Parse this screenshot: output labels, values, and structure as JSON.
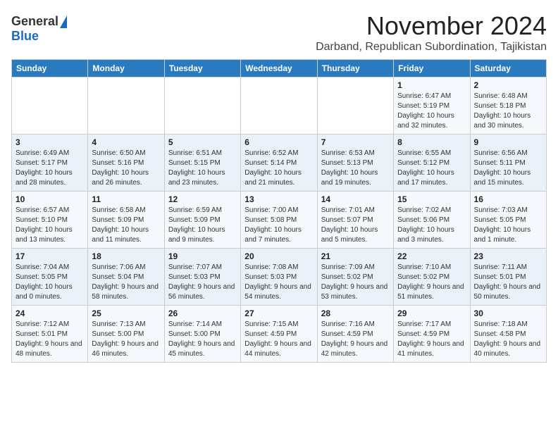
{
  "header": {
    "logo_general": "General",
    "logo_blue": "Blue",
    "month_title": "November 2024",
    "location": "Darband, Republican Subordination, Tajikistan"
  },
  "weekdays": [
    "Sunday",
    "Monday",
    "Tuesday",
    "Wednesday",
    "Thursday",
    "Friday",
    "Saturday"
  ],
  "weeks": [
    [
      {
        "day": "",
        "info": ""
      },
      {
        "day": "",
        "info": ""
      },
      {
        "day": "",
        "info": ""
      },
      {
        "day": "",
        "info": ""
      },
      {
        "day": "",
        "info": ""
      },
      {
        "day": "1",
        "info": "Sunrise: 6:47 AM\nSunset: 5:19 PM\nDaylight: 10 hours and 32 minutes."
      },
      {
        "day": "2",
        "info": "Sunrise: 6:48 AM\nSunset: 5:18 PM\nDaylight: 10 hours and 30 minutes."
      }
    ],
    [
      {
        "day": "3",
        "info": "Sunrise: 6:49 AM\nSunset: 5:17 PM\nDaylight: 10 hours and 28 minutes."
      },
      {
        "day": "4",
        "info": "Sunrise: 6:50 AM\nSunset: 5:16 PM\nDaylight: 10 hours and 26 minutes."
      },
      {
        "day": "5",
        "info": "Sunrise: 6:51 AM\nSunset: 5:15 PM\nDaylight: 10 hours and 23 minutes."
      },
      {
        "day": "6",
        "info": "Sunrise: 6:52 AM\nSunset: 5:14 PM\nDaylight: 10 hours and 21 minutes."
      },
      {
        "day": "7",
        "info": "Sunrise: 6:53 AM\nSunset: 5:13 PM\nDaylight: 10 hours and 19 minutes."
      },
      {
        "day": "8",
        "info": "Sunrise: 6:55 AM\nSunset: 5:12 PM\nDaylight: 10 hours and 17 minutes."
      },
      {
        "day": "9",
        "info": "Sunrise: 6:56 AM\nSunset: 5:11 PM\nDaylight: 10 hours and 15 minutes."
      }
    ],
    [
      {
        "day": "10",
        "info": "Sunrise: 6:57 AM\nSunset: 5:10 PM\nDaylight: 10 hours and 13 minutes."
      },
      {
        "day": "11",
        "info": "Sunrise: 6:58 AM\nSunset: 5:09 PM\nDaylight: 10 hours and 11 minutes."
      },
      {
        "day": "12",
        "info": "Sunrise: 6:59 AM\nSunset: 5:09 PM\nDaylight: 10 hours and 9 minutes."
      },
      {
        "day": "13",
        "info": "Sunrise: 7:00 AM\nSunset: 5:08 PM\nDaylight: 10 hours and 7 minutes."
      },
      {
        "day": "14",
        "info": "Sunrise: 7:01 AM\nSunset: 5:07 PM\nDaylight: 10 hours and 5 minutes."
      },
      {
        "day": "15",
        "info": "Sunrise: 7:02 AM\nSunset: 5:06 PM\nDaylight: 10 hours and 3 minutes."
      },
      {
        "day": "16",
        "info": "Sunrise: 7:03 AM\nSunset: 5:05 PM\nDaylight: 10 hours and 1 minute."
      }
    ],
    [
      {
        "day": "17",
        "info": "Sunrise: 7:04 AM\nSunset: 5:05 PM\nDaylight: 10 hours and 0 minutes."
      },
      {
        "day": "18",
        "info": "Sunrise: 7:06 AM\nSunset: 5:04 PM\nDaylight: 9 hours and 58 minutes."
      },
      {
        "day": "19",
        "info": "Sunrise: 7:07 AM\nSunset: 5:03 PM\nDaylight: 9 hours and 56 minutes."
      },
      {
        "day": "20",
        "info": "Sunrise: 7:08 AM\nSunset: 5:03 PM\nDaylight: 9 hours and 54 minutes."
      },
      {
        "day": "21",
        "info": "Sunrise: 7:09 AM\nSunset: 5:02 PM\nDaylight: 9 hours and 53 minutes."
      },
      {
        "day": "22",
        "info": "Sunrise: 7:10 AM\nSunset: 5:02 PM\nDaylight: 9 hours and 51 minutes."
      },
      {
        "day": "23",
        "info": "Sunrise: 7:11 AM\nSunset: 5:01 PM\nDaylight: 9 hours and 50 minutes."
      }
    ],
    [
      {
        "day": "24",
        "info": "Sunrise: 7:12 AM\nSunset: 5:01 PM\nDaylight: 9 hours and 48 minutes."
      },
      {
        "day": "25",
        "info": "Sunrise: 7:13 AM\nSunset: 5:00 PM\nDaylight: 9 hours and 46 minutes."
      },
      {
        "day": "26",
        "info": "Sunrise: 7:14 AM\nSunset: 5:00 PM\nDaylight: 9 hours and 45 minutes."
      },
      {
        "day": "27",
        "info": "Sunrise: 7:15 AM\nSunset: 4:59 PM\nDaylight: 9 hours and 44 minutes."
      },
      {
        "day": "28",
        "info": "Sunrise: 7:16 AM\nSunset: 4:59 PM\nDaylight: 9 hours and 42 minutes."
      },
      {
        "day": "29",
        "info": "Sunrise: 7:17 AM\nSunset: 4:59 PM\nDaylight: 9 hours and 41 minutes."
      },
      {
        "day": "30",
        "info": "Sunrise: 7:18 AM\nSunset: 4:58 PM\nDaylight: 9 hours and 40 minutes."
      }
    ]
  ]
}
